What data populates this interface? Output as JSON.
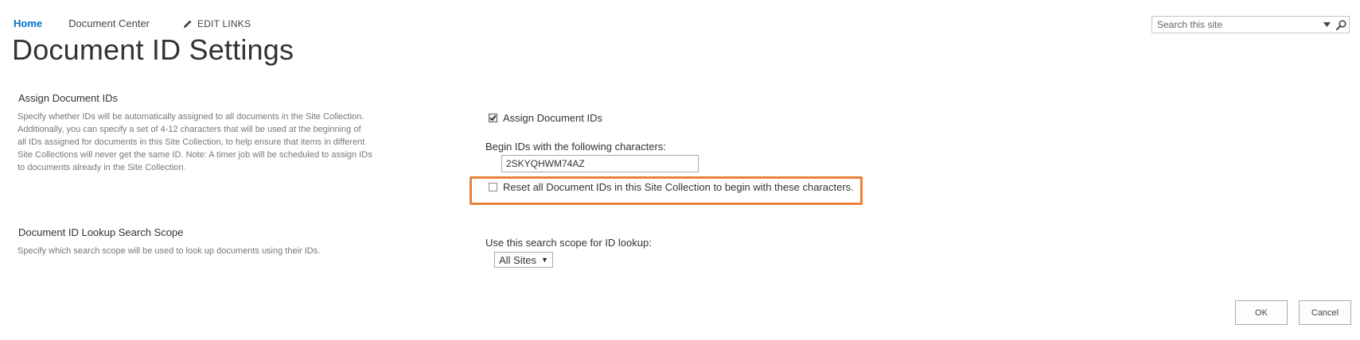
{
  "nav": {
    "home": "Home",
    "document_center": "Document Center",
    "edit_links": "EDIT LINKS"
  },
  "page_title": "Document ID Settings",
  "search": {
    "placeholder": "Search this site"
  },
  "assign_section": {
    "title": "Assign Document IDs",
    "description": "Specify whether IDs will be automatically assigned to all documents in the Site Collection. Additionally, you can specify a set of 4-12 characters that will be used at the beginning of all IDs assigned for documents in this Site Collection, to help ensure that items in different Site Collections will never get the same ID. Note: A timer job will be scheduled to assign IDs to documents already in the Site Collection.",
    "description_lines": [
      "Specify whether IDs will be automatically assigned to all documents in the Site Collection.",
      "Additionally, you can specify a set of 4-12 characters that will be used at the beginning of",
      "all IDs assigned for documents in this Site Collection, to help ensure that items in different",
      "Site Collections will never get the same ID. Note: A timer job will be scheduled to assign IDs",
      "to documents already in the Site Collection."
    ],
    "assign_checkbox_label": "Assign Document IDs",
    "assign_checked": true,
    "begin_label": "Begin IDs with the following characters:",
    "begin_value": "2SKYQHWM74AZ",
    "reset_checkbox_label": "Reset all Document IDs in this Site Collection to begin with these characters.",
    "reset_checked": false
  },
  "lookup_section": {
    "title": "Document ID Lookup Search Scope",
    "description": "Specify which search scope will be used to look up documents using their IDs.",
    "scope_label": "Use this search scope for ID lookup:",
    "scope_value": "All Sites"
  },
  "buttons": {
    "ok": "OK",
    "cancel": "Cancel"
  },
  "colors": {
    "accent": "#0072c6",
    "highlight": "#e8823a"
  }
}
